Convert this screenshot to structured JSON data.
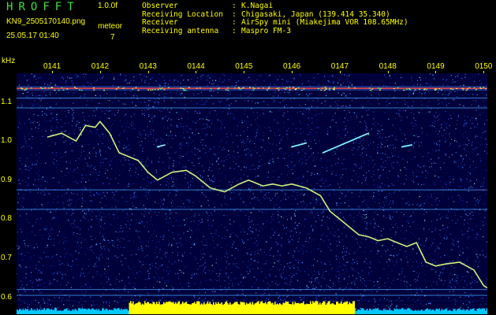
{
  "header": {
    "title_letters": [
      "H",
      "R",
      "O",
      "F",
      "F",
      "T"
    ],
    "version": "1.0.0f",
    "filename": "KN9_2505170140.png",
    "timestamp": "25.05.17 01:40",
    "meteor_label": "meteor",
    "meteor_count": "7"
  },
  "info": [
    {
      "label": "Observer",
      "value": "K.Nagai"
    },
    {
      "label": "Receiving Location",
      "value": "Chigasaki, Japan (139.414 35.340)"
    },
    {
      "label": "Receiver",
      "value": "AirSpy mini (Miakejima VOR 108.65MHz)"
    },
    {
      "label": "Receiving antenna",
      "value": "Maspro FM-3"
    }
  ],
  "chart_data": {
    "type": "heatmap",
    "title": "",
    "y_unit": "kHz",
    "yticks": [
      "1.1",
      "1.0",
      "0.9",
      "0.8",
      "0.7",
      "0.6"
    ],
    "ylim": [
      0.55,
      1.17
    ],
    "xticks": [
      "0141",
      "0142",
      "0143",
      "0144",
      "0145",
      "0146",
      "0147",
      "0148",
      "0149",
      "0150"
    ],
    "xlim_minutes": [
      0,
      10
    ],
    "carrier_khz": 1.135,
    "reference_lines_khz": [
      1.11,
      1.085,
      0.875,
      0.825,
      0.62,
      0.605
    ],
    "aircraft_doppler_trace": {
      "minutes": [
        -0.1,
        0.2,
        0.5,
        0.7,
        0.9,
        1.0,
        1.2,
        1.4,
        1.6,
        1.8,
        2.0,
        2.2,
        2.5,
        2.8,
        3.0,
        3.3,
        3.6,
        3.9,
        4.1,
        4.4,
        4.6,
        4.8,
        5.0,
        5.3,
        5.6,
        5.8,
        6.0,
        6.2,
        6.4,
        6.6,
        6.8,
        7.0,
        7.2,
        7.4,
        7.6,
        7.8,
        8.0,
        8.2,
        8.5,
        8.8,
        9.0,
        9.2,
        9.4,
        9.6
      ],
      "khz": [
        1.01,
        1.02,
        1.0,
        1.04,
        1.035,
        1.05,
        1.02,
        0.97,
        0.96,
        0.95,
        0.92,
        0.9,
        0.92,
        0.925,
        0.91,
        0.88,
        0.87,
        0.89,
        0.9,
        0.885,
        0.89,
        0.885,
        0.89,
        0.88,
        0.86,
        0.82,
        0.8,
        0.78,
        0.76,
        0.755,
        0.745,
        0.75,
        0.74,
        0.73,
        0.74,
        0.69,
        0.68,
        0.685,
        0.69,
        0.67,
        0.63,
        0.615,
        0.6,
        0.58
      ]
    },
    "meteor_streaks": [
      {
        "start_min": 5.0,
        "end_min": 5.3,
        "start_khz": 0.985,
        "end_khz": 0.995
      },
      {
        "start_min": 5.65,
        "end_min": 6.6,
        "start_khz": 0.97,
        "end_khz": 1.02
      },
      {
        "start_min": 2.2,
        "end_min": 2.35,
        "start_khz": 0.985,
        "end_khz": 0.99
      },
      {
        "start_min": 7.3,
        "end_min": 7.5,
        "start_khz": 0.985,
        "end_khz": 0.99
      }
    ]
  },
  "colors": {
    "background": "#000000",
    "label_text": "#ffff00",
    "title_letters": "#3fe03f",
    "plot_noise_base": "#00003a",
    "trace": "#d8ff80",
    "carrier_line": "#ff4040",
    "reference_line": "#4aa8ff",
    "power_bar_active": "#ffff00",
    "power_bar_idle": "#00c8ff"
  },
  "power_bar": {
    "active_start_min": 1.6,
    "active_end_min": 6.3
  }
}
